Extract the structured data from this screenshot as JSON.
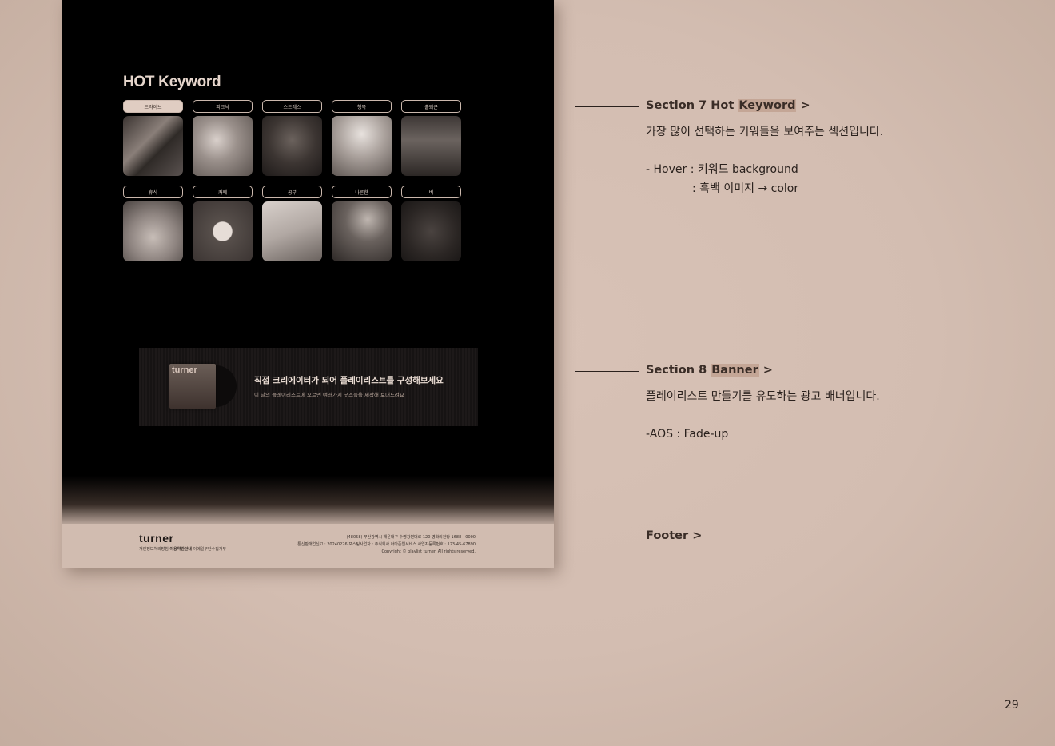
{
  "mockup": {
    "hot_keyword": {
      "title": "HOT Keyword",
      "keywords": [
        {
          "label": "드라이브",
          "active": true
        },
        {
          "label": "피크닉",
          "active": false
        },
        {
          "label": "스트레스",
          "active": false
        },
        {
          "label": "행복",
          "active": false
        },
        {
          "label": "출퇴근",
          "active": false
        },
        {
          "label": "휴식",
          "active": false
        },
        {
          "label": "카페",
          "active": false
        },
        {
          "label": "공부",
          "active": false
        },
        {
          "label": "나른한",
          "active": false
        },
        {
          "label": "비",
          "active": false
        }
      ]
    },
    "banner": {
      "album_logo": "turner",
      "title": "직접 크리에이터가 되어 플레이리스트를 구성해보세요",
      "subtitle": "이 달의 플레이리스트에 오르면 여러가지 굿즈들을 제작해 보내드려요"
    },
    "footer": {
      "logo": "turner",
      "links": [
        "개인정보처리방침",
        "이용약관안내",
        "이메일무단수집거부"
      ],
      "info_lines": [
        "(48058) 부산광역시 해운대구 수영강변대로 120 영화의전당 1688 - 0000",
        "통신판매업신고 : 20240226 포스팅사업자 : 주식회사 아마존웹서비스 사업자등록번호 : 123-45-67890",
        "Copyright © playlist turner. All rights reserved."
      ]
    }
  },
  "annotations": {
    "section7": {
      "prefix": "Section 7 Hot ",
      "highlight": "Keyword",
      "suffix": " >",
      "desc": "가장 많이 선택하는 키워들을 보여주는 섹션입니다.",
      "hover1": "- Hover : 키워드 background",
      "hover2": ": 흑백 이미지 → color"
    },
    "section8": {
      "prefix": "Section 8 ",
      "highlight": "Banner",
      "suffix": " >",
      "desc": "플레이리스트 만들기를 유도하는 광고 배너입니다.",
      "aos": "-AOS : Fade-up"
    },
    "footer": {
      "title": "Footer >"
    }
  },
  "page_number": "29",
  "colors": {
    "background": "#d3bdb1",
    "highlight": "#c4a696",
    "mockup_bg": "#000000",
    "active_keyword": "#e0cdc2"
  }
}
